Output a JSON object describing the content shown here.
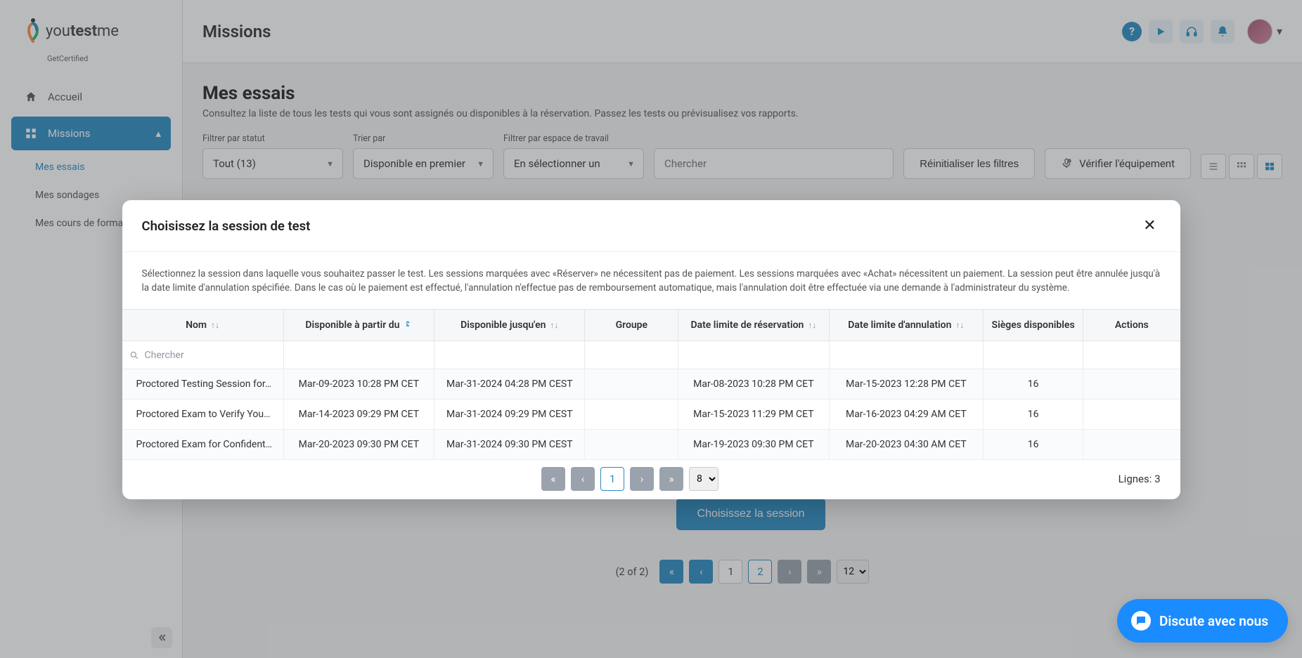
{
  "brand": {
    "name_plain": "you",
    "name_bold": "test",
    "name_tail": "me",
    "sub": "GetCertified"
  },
  "topbar": {
    "title": "Missions"
  },
  "sidebar": {
    "home": "Accueil",
    "missions": "Missions",
    "sub": [
      {
        "label": "Mes essais",
        "selected": true
      },
      {
        "label": "Mes sondages",
        "selected": false
      },
      {
        "label": "Mes cours de format...",
        "selected": false
      }
    ]
  },
  "page": {
    "title": "Mes essais",
    "subtitle": "Consultez la liste de tous les tests qui vous sont assignés ou disponibles à la réservation. Passez les tests ou prévisualisez vos rapports."
  },
  "filters": {
    "status_label": "Filtrer par statut",
    "status_value": "Tout (13)",
    "sort_label": "Trier par",
    "sort_value": "Disponible en premier",
    "workspace_label": "Filtrer par espace de travail",
    "workspace_value": "En sélectionner un",
    "search_placeholder": "Chercher",
    "reset": "Réinitialiser les filtres",
    "equip": "Vérifier l'équipement"
  },
  "bg_choose_btn": "Choisissez la session",
  "bg_pagination": {
    "label": "(2 of 2)",
    "pages": [
      "1",
      "2"
    ],
    "active": "2",
    "size": "12"
  },
  "modal": {
    "title": "Choisissez la session de test",
    "description": "Sélectionnez la session dans laquelle vous souhaitez passer le test. Les sessions marquées avec «Réserver» ne nécessitent pas de paiement. Les sessions marquées avec «Achat» nécessitent un paiement. La session peut être annulée jusqu'à la date limite d'annulation spécifiée. Dans le cas où le paiement est effectué, l'annulation n'effectue pas de remboursement automatique, mais l'annulation doit être effectuée via une demande à l'administrateur du système.",
    "columns": {
      "name": "Nom",
      "available_from": "Disponible à partir du",
      "available_until": "Disponible jusqu'en",
      "group": "Groupe",
      "booking_deadline": "Date limite de réservation",
      "cancel_deadline": "Date limite d'annulation",
      "seats": "Sièges disponibles",
      "actions": "Actions"
    },
    "search_placeholder": "Chercher",
    "rows": [
      {
        "name": "Proctored Testing Session for…",
        "from": "Mar-09-2023 10:28 PM CET",
        "until": "Mar-31-2024 04:28 PM CEST",
        "group": "",
        "booking": "Mar-08-2023 10:28 PM CET",
        "cancel": "Mar-15-2023 12:28 PM CET",
        "seats": "16"
      },
      {
        "name": "Proctored Exam to Verify You…",
        "from": "Mar-14-2023 09:29 PM CET",
        "until": "Mar-31-2024 09:29 PM CEST",
        "group": "",
        "booking": "Mar-15-2023 11:29 PM CET",
        "cancel": "Mar-16-2023 04:29 AM CET",
        "seats": "16"
      },
      {
        "name": "Proctored Exam for Confident…",
        "from": "Mar-20-2023 09:30 PM CET",
        "until": "Mar-31-2024 09:30 PM CEST",
        "group": "",
        "booking": "Mar-19-2023 09:30 PM CET",
        "cancel": "Mar-20-2023 04:30 AM CET",
        "seats": "16"
      }
    ],
    "pagination": {
      "page": "1",
      "size": "8",
      "lines_label": "Lignes: 3"
    }
  },
  "chat": {
    "label": "Discute avec nous"
  }
}
